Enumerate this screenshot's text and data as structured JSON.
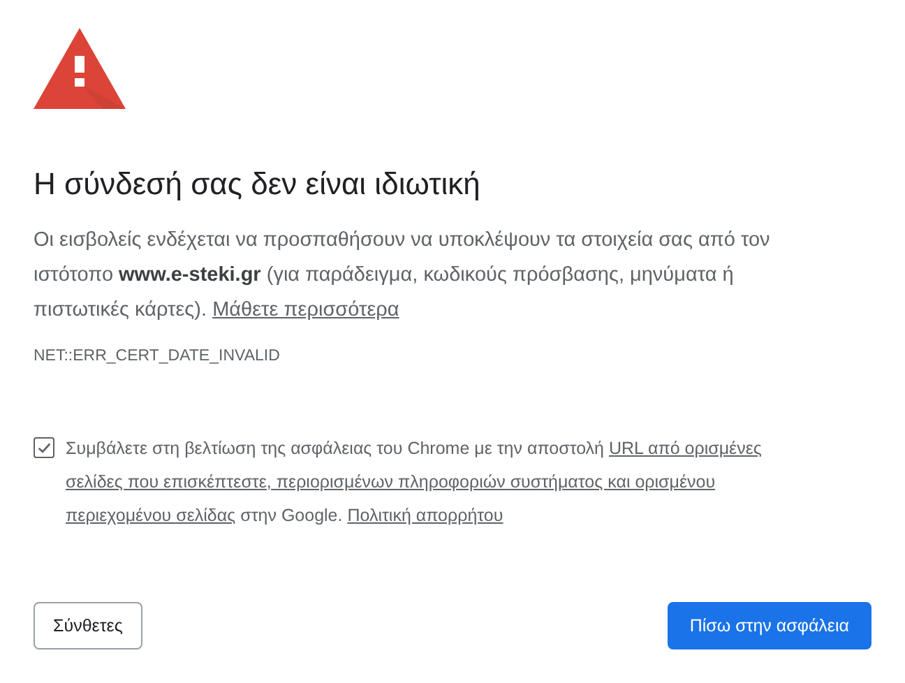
{
  "heading": "Η σύνδεσή σας δεν είναι ιδιωτική",
  "message": [
    {
      "kind": "text",
      "text": "Οι εισβολείς ενδέχεται να προσπαθήσουν να υποκλέψουν τα στοιχεία σας από τον ιστότοπο **www.e-steki.gr** (για παράδειγμα, κωδικούς πρόσβασης, μηνύματα ή πιστωτικές κάρτες). "
    },
    {
      "kind": "link",
      "text": "Μάθετε περισσότερα"
    }
  ],
  "error_code": "NET::ERR_CERT_DATE_INVALID",
  "opt_in": {
    "checked": true,
    "lines": [
      [
        {
          "kind": "text",
          "text": "Συμβάλετε στη βελτίωση της ασφάλειας του Chrome με την αποστολή "
        },
        {
          "kind": "link",
          "text": "URL από ορισμένες"
        }
      ],
      [
        {
          "kind": "link",
          "text": "σελίδες που επισκέπτεστε, περιορισμένων πληροφοριών συστήματος και ορισμένου"
        }
      ],
      [
        {
          "kind": "link",
          "text": "περιεχομένου σελίδας"
        },
        {
          "kind": "text",
          "text": " στην Google. "
        },
        {
          "kind": "link",
          "text": "Πολιτική απορρήτου"
        }
      ]
    ]
  },
  "buttons": [
    {
      "label": "Σύνθετες",
      "kind": "secondary"
    },
    {
      "label": "Πίσω στην ασφάλεια",
      "kind": "primary"
    }
  ]
}
